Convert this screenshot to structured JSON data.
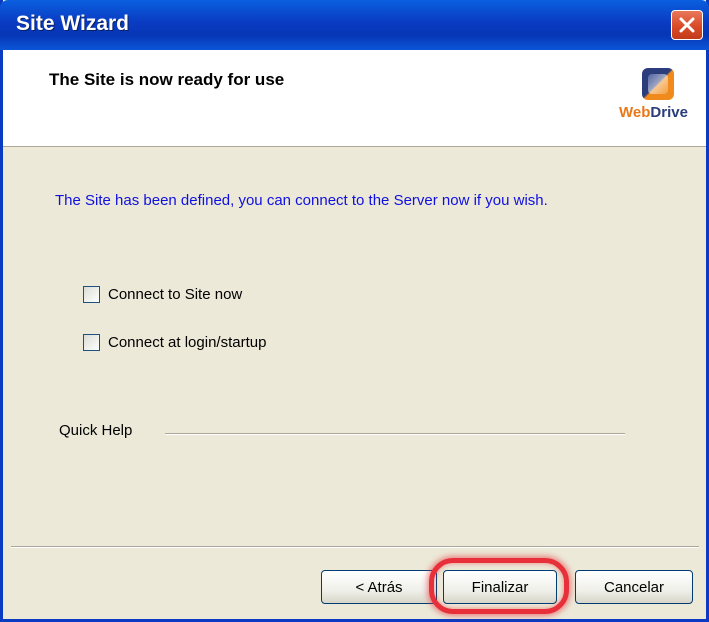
{
  "window": {
    "title": "Site Wizard"
  },
  "header": {
    "title": "The Site is now ready for use",
    "logo_text_web": "Web",
    "logo_text_drive": "Drive"
  },
  "content": {
    "intro": "The Site has been defined, you can connect to the Server now if you wish.",
    "options": [
      {
        "label": "Connect to Site now",
        "checked": false
      },
      {
        "label": "Connect at login/startup",
        "checked": false
      }
    ],
    "quick_help_label": "Quick Help"
  },
  "buttons": {
    "back": "< Atrás",
    "finish": "Finalizar",
    "cancel": "Cancelar"
  },
  "icons": {
    "close": "close-icon",
    "logo": "webdrive-logo-icon"
  },
  "colors": {
    "titlebar": "#0a3bc2",
    "intro_text": "#1010e0",
    "highlight": "#e8303a",
    "dialog_bg": "#ece9d8"
  }
}
